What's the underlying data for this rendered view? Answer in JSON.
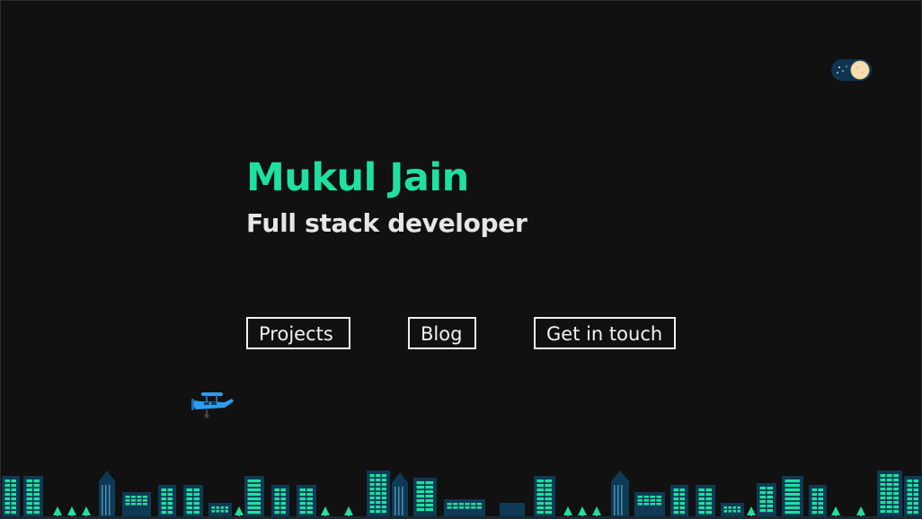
{
  "hero": {
    "name": "Mukul Jain",
    "role": "Full stack developer"
  },
  "nav": {
    "projects_label": "Projects",
    "blog_label": "Blog",
    "contact_label": "Get in touch"
  },
  "theme_toggle": {
    "mode": "dark",
    "icon": "moon-icon"
  },
  "decorations": {
    "plane_icon": "airplane-icon",
    "skyline": "city-skyline-illustration"
  },
  "colors": {
    "background": "#111111",
    "accent": "#1fe0a0",
    "text": "#e6e6e6",
    "building": "#0e3a55",
    "window": "#1fe0a0",
    "tree": "#1fe0a0",
    "plane": "#2a9df4"
  }
}
